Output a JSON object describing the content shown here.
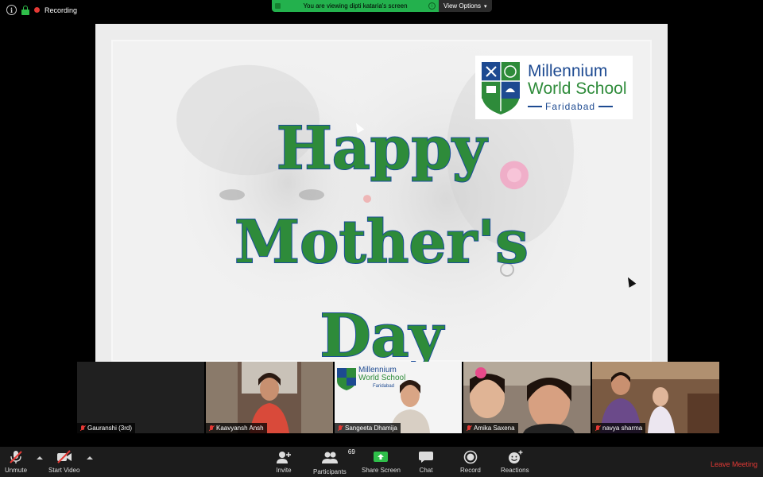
{
  "top_status": {
    "recording_label": "Recording"
  },
  "banner": {
    "viewing_text": "You are viewing dipti kataria's screen",
    "view_options_label": "View Options"
  },
  "shared_screen": {
    "headline": [
      "Happy",
      "Mother's",
      "Day"
    ],
    "logo": {
      "line1": "Millennium",
      "line2": "World School",
      "line3": "Faridabad"
    }
  },
  "participants": [
    {
      "name": "Gauranshi (3rd)",
      "video": false
    },
    {
      "name": "Kaavyansh Ansh",
      "video": true
    },
    {
      "name": "Sangeeta Dhamija",
      "video": true
    },
    {
      "name": "Amika Saxena",
      "video": true
    },
    {
      "name": "navya sharma",
      "video": true
    }
  ],
  "participant_tile_logo": {
    "line1": "Millennium",
    "line2": "World School",
    "line3": "Faridabad"
  },
  "toolbar": {
    "unmute": "Unmute",
    "start_video": "Start Video",
    "invite": "Invite",
    "participants": "Participants",
    "participants_count": "69",
    "share_screen": "Share Screen",
    "chat": "Chat",
    "record": "Record",
    "reactions": "Reactions",
    "leave": "Leave Meeting"
  },
  "colors": {
    "banner_green": "#23b14d",
    "headline_green": "#2e8b3a",
    "headline_outline": "#1a4c9a",
    "leave_red": "#e53935",
    "logo_blue": "#1d4a91"
  }
}
